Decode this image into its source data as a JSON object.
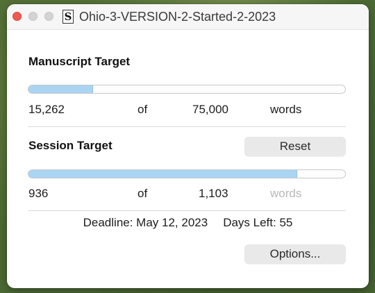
{
  "window": {
    "title": "Ohio-3-VERSION-2-Started-2-2023",
    "doc_icon_glyph": "S"
  },
  "manuscript": {
    "heading": "Manuscript Target",
    "progress_fraction": 0.2035,
    "current": "15,262",
    "of_label": "of",
    "target": "75,000",
    "unit": "words"
  },
  "session": {
    "heading": "Session Target",
    "reset_label": "Reset",
    "progress_fraction": 0.849,
    "current": "936",
    "of_label": "of",
    "target": "1,103",
    "unit": "words"
  },
  "footer": {
    "deadline": "Deadline: May 12, 2023",
    "days_left": "Days Left: 55"
  },
  "options_label": "Options...",
  "colors": {
    "progress_fill": "#a9d4f2",
    "close_button": "#ee5a52"
  }
}
